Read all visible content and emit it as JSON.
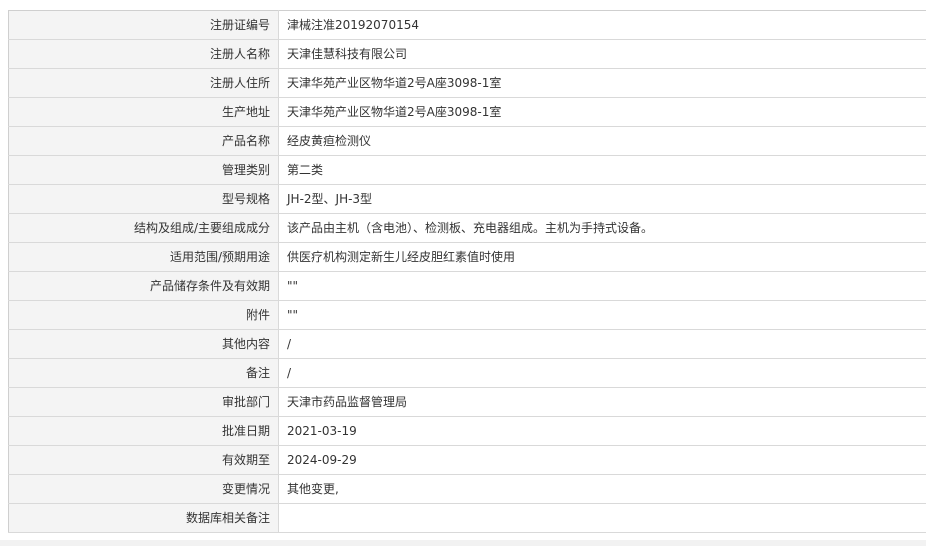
{
  "record": {
    "rows": [
      {
        "label": "注册证编号",
        "value": "津械注准20192070154"
      },
      {
        "label": "注册人名称",
        "value": "天津佳慧科技有限公司"
      },
      {
        "label": "注册人住所",
        "value": "天津华苑产业区物华道2号A座3098-1室"
      },
      {
        "label": "生产地址",
        "value": "天津华苑产业区物华道2号A座3098-1室"
      },
      {
        "label": "产品名称",
        "value": "经皮黄疸检测仪"
      },
      {
        "label": "管理类别",
        "value": "第二类"
      },
      {
        "label": "型号规格",
        "value": "JH-2型、JH-3型"
      },
      {
        "label": "结构及组成/主要组成成分",
        "value": "该产品由主机（含电池）、检测板、充电器组成。主机为手持式设备。"
      },
      {
        "label": "适用范围/预期用途",
        "value": "供医疗机构测定新生儿经皮胆红素值时使用"
      },
      {
        "label": "产品储存条件及有效期",
        "value": "\"\""
      },
      {
        "label": "附件",
        "value": "\"\""
      },
      {
        "label": "其他内容",
        "value": "/"
      },
      {
        "label": "备注",
        "value": "/"
      },
      {
        "label": "审批部门",
        "value": "天津市药品监督管理局"
      },
      {
        "label": "批准日期",
        "value": "2021-03-19"
      },
      {
        "label": "有效期至",
        "value": "2024-09-29"
      },
      {
        "label": "变更情况",
        "value": "其他变更,"
      },
      {
        "label": "数据库相关备注",
        "value": ""
      }
    ]
  },
  "colors": {
    "label_bg": "#f4f4f4",
    "border": "#d9d9d9",
    "text": "#333333"
  }
}
